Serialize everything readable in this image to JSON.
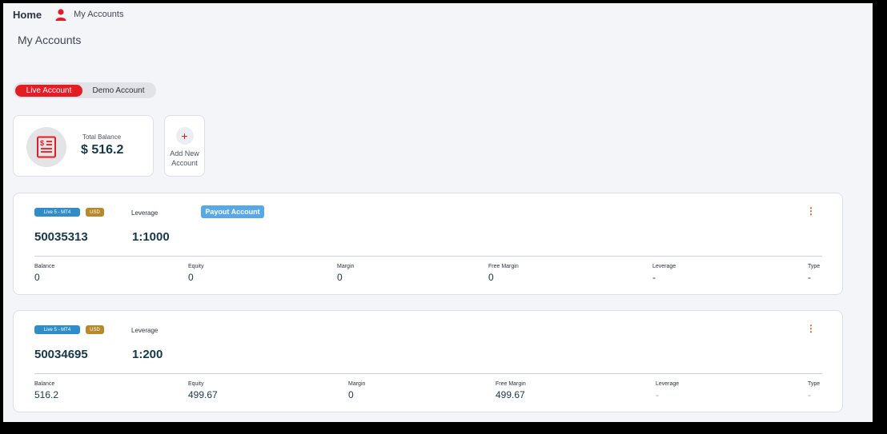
{
  "header": {
    "home_label": "Home",
    "crumb_label": "My Accounts"
  },
  "page_title": "My Accounts",
  "toggle": {
    "live_label": "Live Account",
    "demo_label": "Demo Account",
    "selected": "live"
  },
  "balance": {
    "label": "Total Balance",
    "value": "$ 516.2"
  },
  "add_account": {
    "symbol": "+",
    "label_line1": "Add New",
    "label_line2": "Account"
  },
  "colors": {
    "accent": "#e41c24",
    "badge_type": "#2f8ec9",
    "badge_currency": "#b68a2c",
    "payout": "#56a9e6",
    "value_text": "#15384a"
  },
  "icons": {
    "user": "user-icon",
    "balance": "invoice-dollar-icon",
    "menu": "more-vertical-icon"
  },
  "accounts": [
    {
      "type_badge": "Live 5 - MT4",
      "currency_badge": "USD",
      "leverage_label": "Leverage",
      "payout_label": "Payout Account",
      "number": "50035313",
      "leverage": "1:1000",
      "stats": [
        {
          "label": "Balance",
          "value": "0"
        },
        {
          "label": "Equity",
          "value": "0"
        },
        {
          "label": "Margin",
          "value": "0"
        },
        {
          "label": "Free Margin",
          "value": "0"
        },
        {
          "label": "Leverage",
          "value": "-"
        },
        {
          "label": "Type",
          "value": "-"
        }
      ]
    },
    {
      "type_badge": "Live 5 - MT4",
      "currency_badge": "USD",
      "leverage_label": "Leverage",
      "number": "50034695",
      "leverage": "1:200",
      "stats": [
        {
          "label": "Balance",
          "value": "516.2"
        },
        {
          "label": "Equity",
          "value": "499.67"
        },
        {
          "label": "Margin",
          "value": "0"
        },
        {
          "label": "Free Margin",
          "value": "499.67"
        },
        {
          "label": "Leverage",
          "value": "-"
        },
        {
          "label": "Type",
          "value": "-"
        }
      ]
    }
  ]
}
